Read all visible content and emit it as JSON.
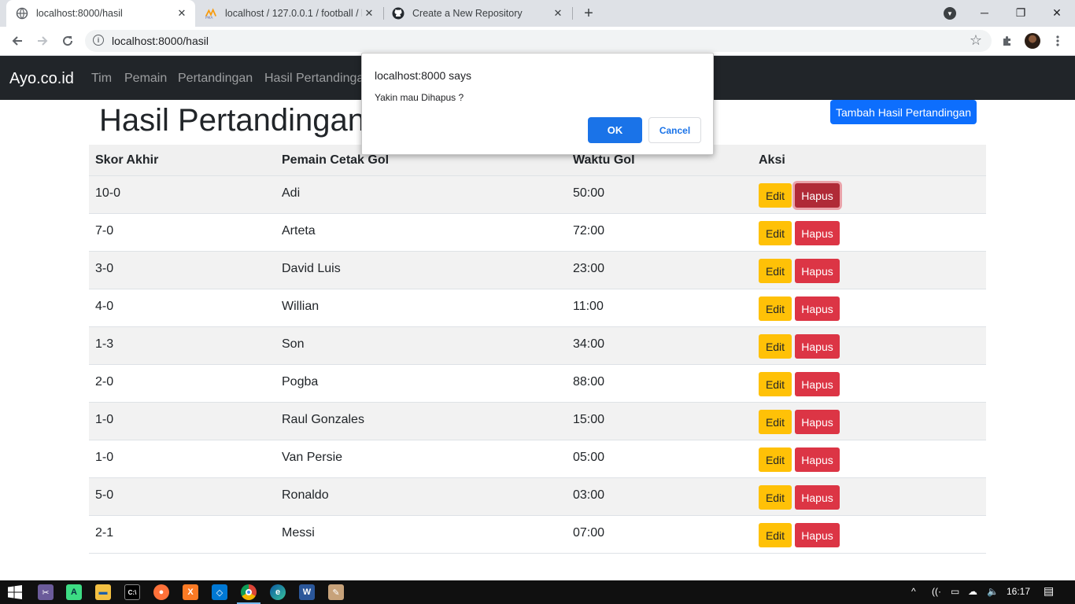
{
  "browser": {
    "tabs": [
      {
        "title": "localhost:8000/hasil",
        "active": true
      },
      {
        "title": "localhost / 127.0.0.1 / football / h",
        "active": false
      },
      {
        "title": "Create a New Repository",
        "active": false
      }
    ],
    "url": "localhost:8000/hasil",
    "controls": {
      "minimize": "─",
      "restore": "❐",
      "close": "✕",
      "new_tab": "+"
    }
  },
  "navbar": {
    "brand": "Ayo.co.id",
    "links": [
      "Tim",
      "Pemain",
      "Pertandingan",
      "Hasil Pertandingan"
    ]
  },
  "main": {
    "title": "Hasil Pertandingan",
    "add_button": "Tambah Hasil Pertandingan",
    "table": {
      "headers": [
        "Skor Akhir",
        "Pemain Cetak Gol",
        "Waktu Gol",
        "Aksi"
      ],
      "rows": [
        {
          "score": "10-0",
          "player": "Adi",
          "time": "50:00"
        },
        {
          "score": "7-0",
          "player": "Arteta",
          "time": "72:00"
        },
        {
          "score": "3-0",
          "player": "David Luis",
          "time": "23:00"
        },
        {
          "score": "4-0",
          "player": "Willian",
          "time": "11:00"
        },
        {
          "score": "1-3",
          "player": "Son",
          "time": "34:00"
        },
        {
          "score": "2-0",
          "player": "Pogba",
          "time": "88:00"
        },
        {
          "score": "1-0",
          "player": "Raul Gonzales",
          "time": "15:00"
        },
        {
          "score": "1-0",
          "player": "Van Persie",
          "time": "05:00"
        },
        {
          "score": "5-0",
          "player": "Ronaldo",
          "time": "03:00"
        },
        {
          "score": "2-1",
          "player": "Messi",
          "time": "07:00"
        }
      ],
      "edit_label": "Edit",
      "delete_label": "Hapus"
    }
  },
  "dialog": {
    "title": "localhost:8000 says",
    "message": "Yakin mau Dihapus ?",
    "ok": "OK",
    "cancel": "Cancel"
  },
  "taskbar": {
    "clock": "16:17",
    "apps": [
      "snipping-tool",
      "android-studio",
      "file-explorer",
      "command-prompt",
      "firefox",
      "xampp",
      "vscode",
      "chrome",
      "edge",
      "word",
      "paint"
    ]
  },
  "colors": {
    "navbar_bg": "#212529",
    "primary": "#0d6efd",
    "warning": "#ffc107",
    "danger": "#dc3545",
    "dialog_ok": "#1a73e8"
  }
}
